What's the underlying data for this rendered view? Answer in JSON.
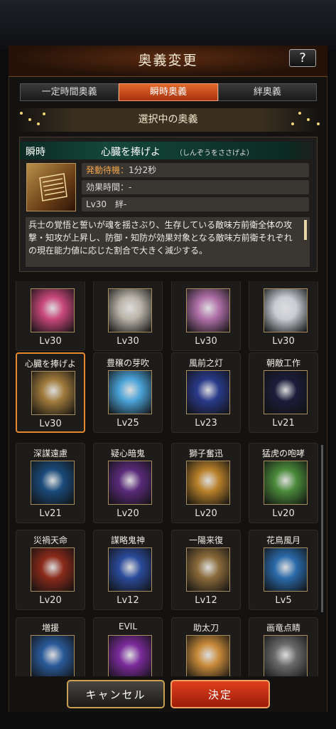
{
  "title": "奥義変更",
  "help_label": "?",
  "tabs": [
    {
      "label": "一定時間奥義",
      "active": false
    },
    {
      "label": "瞬時奥義",
      "active": true
    },
    {
      "label": "絆奥義",
      "active": false
    }
  ],
  "selected_header": "選択中の奥義",
  "selected": {
    "type": "瞬時",
    "name": "心臓を捧げよ",
    "reading": "（しんぞうをささげよ）",
    "wait_label": "発動待機：",
    "wait_value": "1分2秒",
    "duration_label": "効果時間：",
    "duration_value": "-",
    "level_bond": "Lv30　絆-",
    "description": "兵士の覚悟と誓いが魂を揺さぶり、生存している敵味方前衛全体の攻撃・知攻が上昇し、防御・知防が効果対象となる敵味方前衛それぞれの現在能力値に応じた割合で大きく減少する。"
  },
  "cards": [
    {
      "name": "",
      "level": "Lv30",
      "icon": "wrestler-portrait-icon",
      "color": "#c8487a"
    },
    {
      "name": "",
      "level": "Lv30",
      "icon": "cat-icon",
      "color": "#b9b4a8"
    },
    {
      "name": "",
      "level": "Lv30",
      "icon": "robot-mecha-icon",
      "color": "#b070a8"
    },
    {
      "name": "",
      "level": "Lv30",
      "icon": "snow-scene-icon",
      "color": "#c8ccd4"
    },
    {
      "name": "心臓を捧げよ",
      "level": "Lv30",
      "icon": "heart-offering-icon",
      "color": "#a07a3c",
      "selected": true
    },
    {
      "name": "豊穣の芽吹",
      "level": "Lv25",
      "icon": "sprout-icon",
      "color": "#4aa3d8"
    },
    {
      "name": "風前之灯",
      "level": "Lv23",
      "icon": "candle-icon",
      "color": "#2a3a8a"
    },
    {
      "name": "朝敵工作",
      "level": "Lv21",
      "icon": "letter-icon",
      "color": "#1c1c3a"
    },
    {
      "name": "深謀遠慮",
      "level": "Lv21",
      "icon": "yin-yang-icon",
      "color": "#1a4a7a"
    },
    {
      "name": "疑心暗鬼",
      "level": "Lv20",
      "icon": "oni-mask-icon",
      "color": "#5a2a7a"
    },
    {
      "name": "獅子奮迅",
      "level": "Lv20",
      "icon": "lion-icon",
      "color": "#b8802a"
    },
    {
      "name": "猛虎の咆哮",
      "level": "Lv20",
      "icon": "tiger-icon",
      "color": "#4a8a3a"
    },
    {
      "name": "災禍天命",
      "level": "Lv20",
      "icon": "flaming-skull-icon",
      "color": "#8a2a1a"
    },
    {
      "name": "謀略鬼神",
      "level": "Lv12",
      "icon": "shadow-figure-icon",
      "color": "#2a4a9a"
    },
    {
      "name": "一陽来復",
      "level": "Lv12",
      "icon": "butterfly-icon",
      "color": "#8a6a3a"
    },
    {
      "name": "花鳥風月",
      "level": "Lv5",
      "icon": "flower-bird-icon",
      "color": "#2a6aaa"
    },
    {
      "name": "増援",
      "level": "",
      "icon": "banner-icon",
      "color": "#2a5a9a"
    },
    {
      "name": "EVIL",
      "level": "",
      "icon": "evil-portrait-icon",
      "color": "#7a2a9a"
    },
    {
      "name": "助太刀",
      "level": "",
      "icon": "samurai-silhouette-icon",
      "color": "#c88a3a"
    },
    {
      "name": "画竜点睛",
      "level": "",
      "icon": "dragon-icon",
      "color": "#6a6a6a"
    }
  ],
  "buttons": {
    "cancel": "キャンセル",
    "confirm": "決定"
  }
}
